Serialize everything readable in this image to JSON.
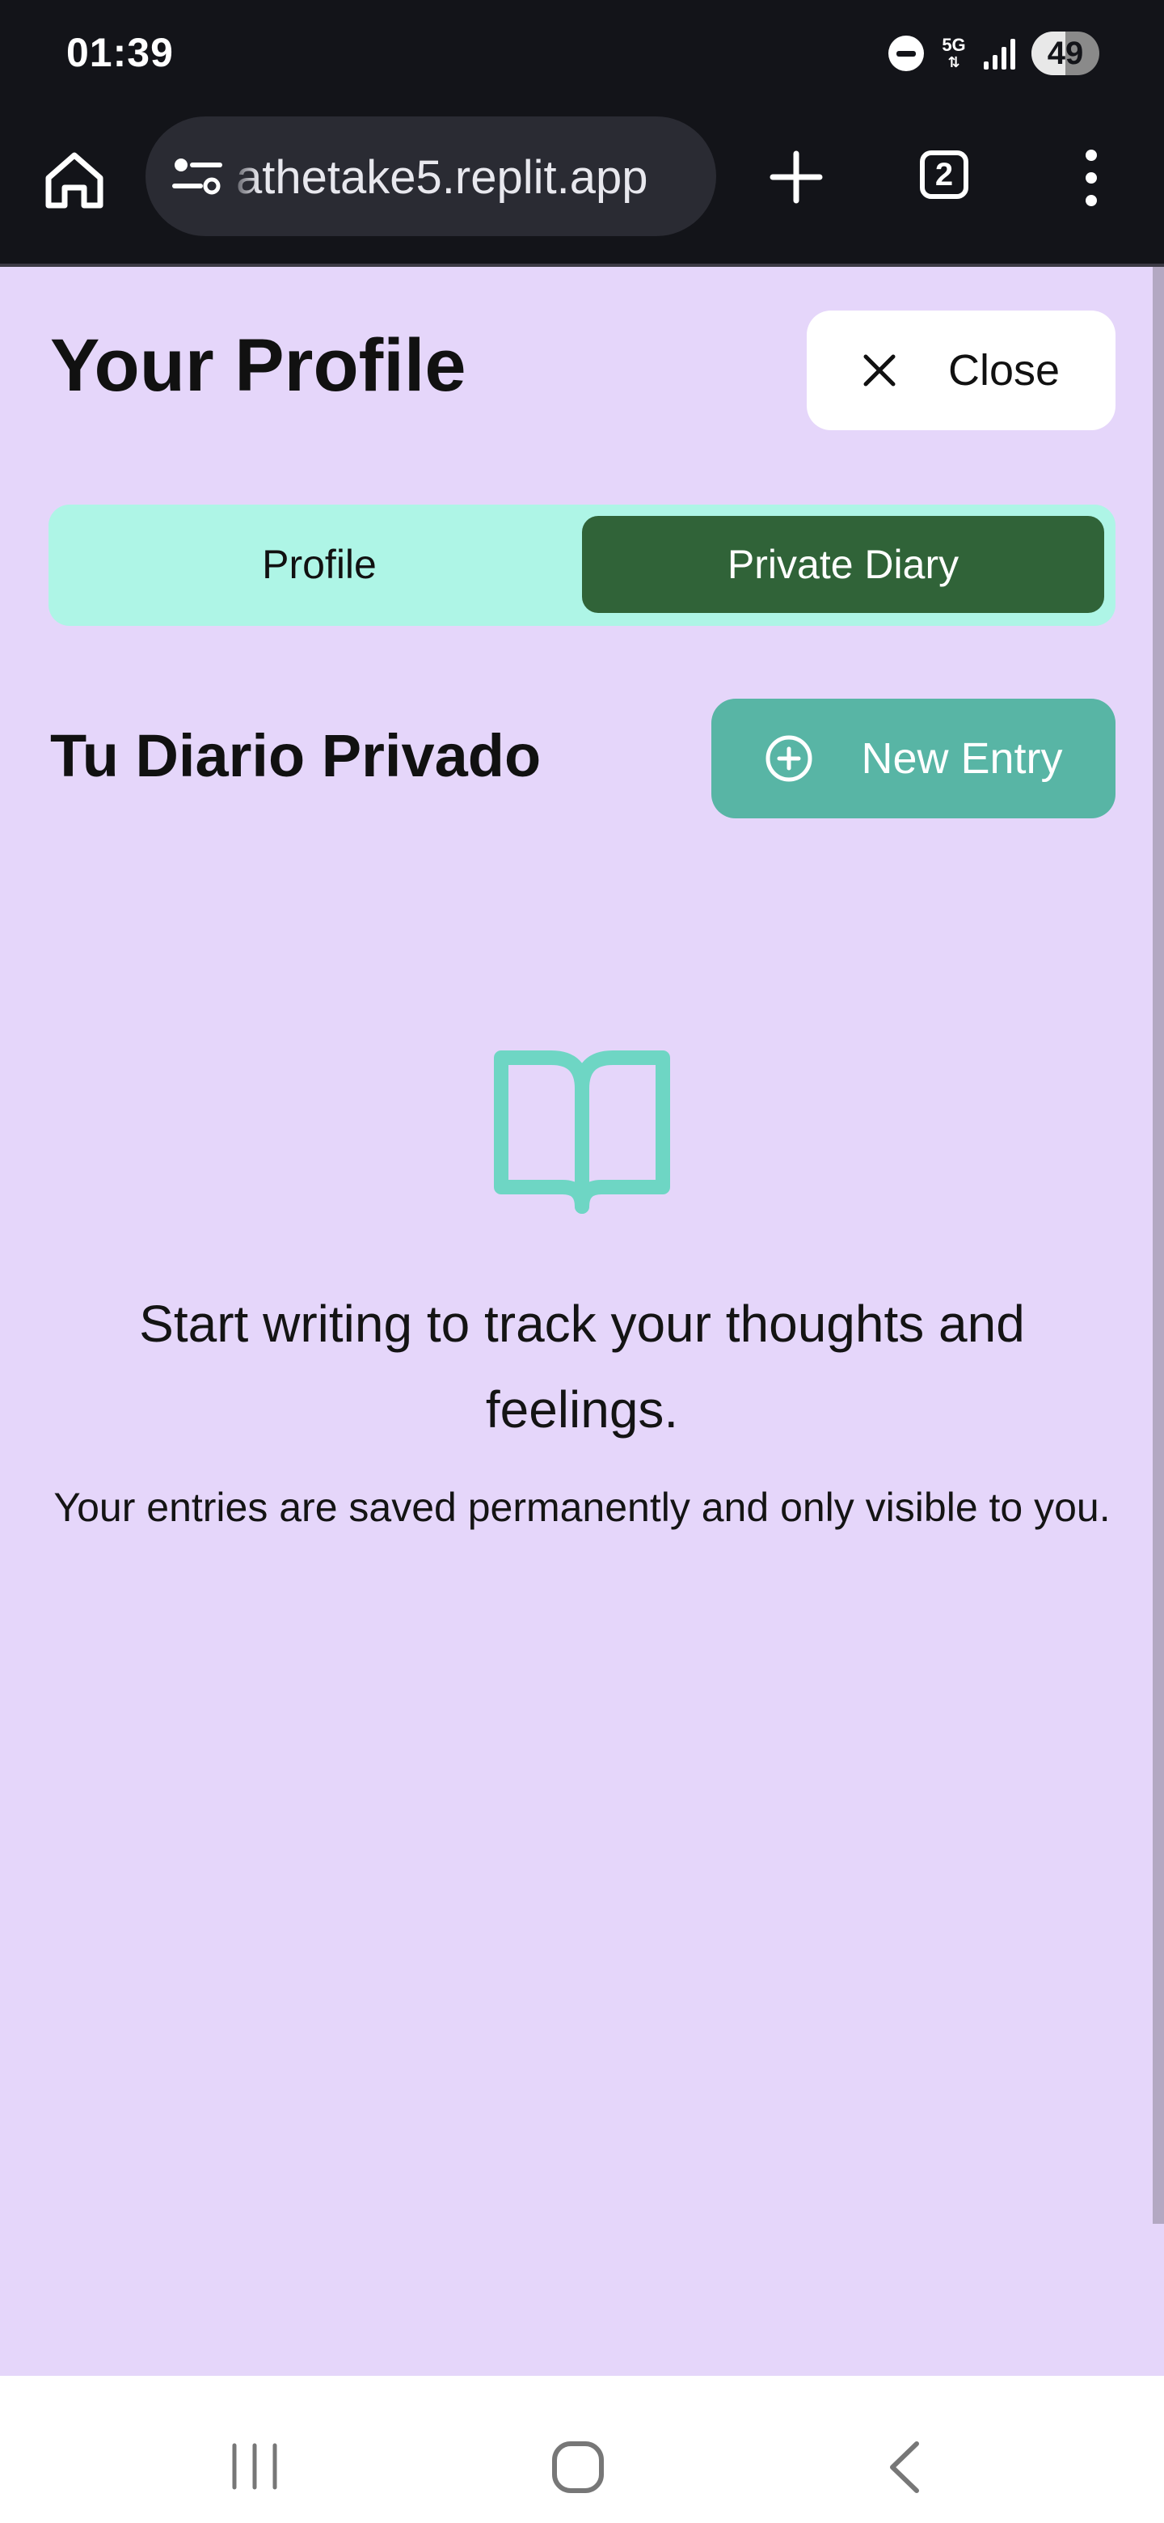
{
  "status_bar": {
    "time": "01:39",
    "network": "5G",
    "battery": "49"
  },
  "browser": {
    "url": "athetake5.replit.app",
    "tab_count": "2"
  },
  "header": {
    "title": "Your Profile",
    "close_label": "Close"
  },
  "tabs": [
    {
      "label": "Profile",
      "active": false
    },
    {
      "label": "Private Diary",
      "active": true
    }
  ],
  "diary": {
    "title": "Tu Diario Privado",
    "new_entry_label": "New Entry",
    "empty_message": "Start writing to track your thoughts and feelings.",
    "empty_subtext": "Your entries are saved permanently and only visible to you."
  },
  "colors": {
    "page_background": "#e5d6fa",
    "tab_bar_background": "#aef5e6",
    "active_tab": "#306338",
    "new_entry_button": "#58b5a5",
    "book_icon": "#6ed6c4"
  },
  "icons": [
    "home-icon",
    "site-settings-icon",
    "plus-icon",
    "tabs-icon",
    "more-icon",
    "close-icon",
    "plus-circle-icon",
    "book-open-icon",
    "recent-apps-icon",
    "home-nav-icon",
    "back-icon"
  ]
}
